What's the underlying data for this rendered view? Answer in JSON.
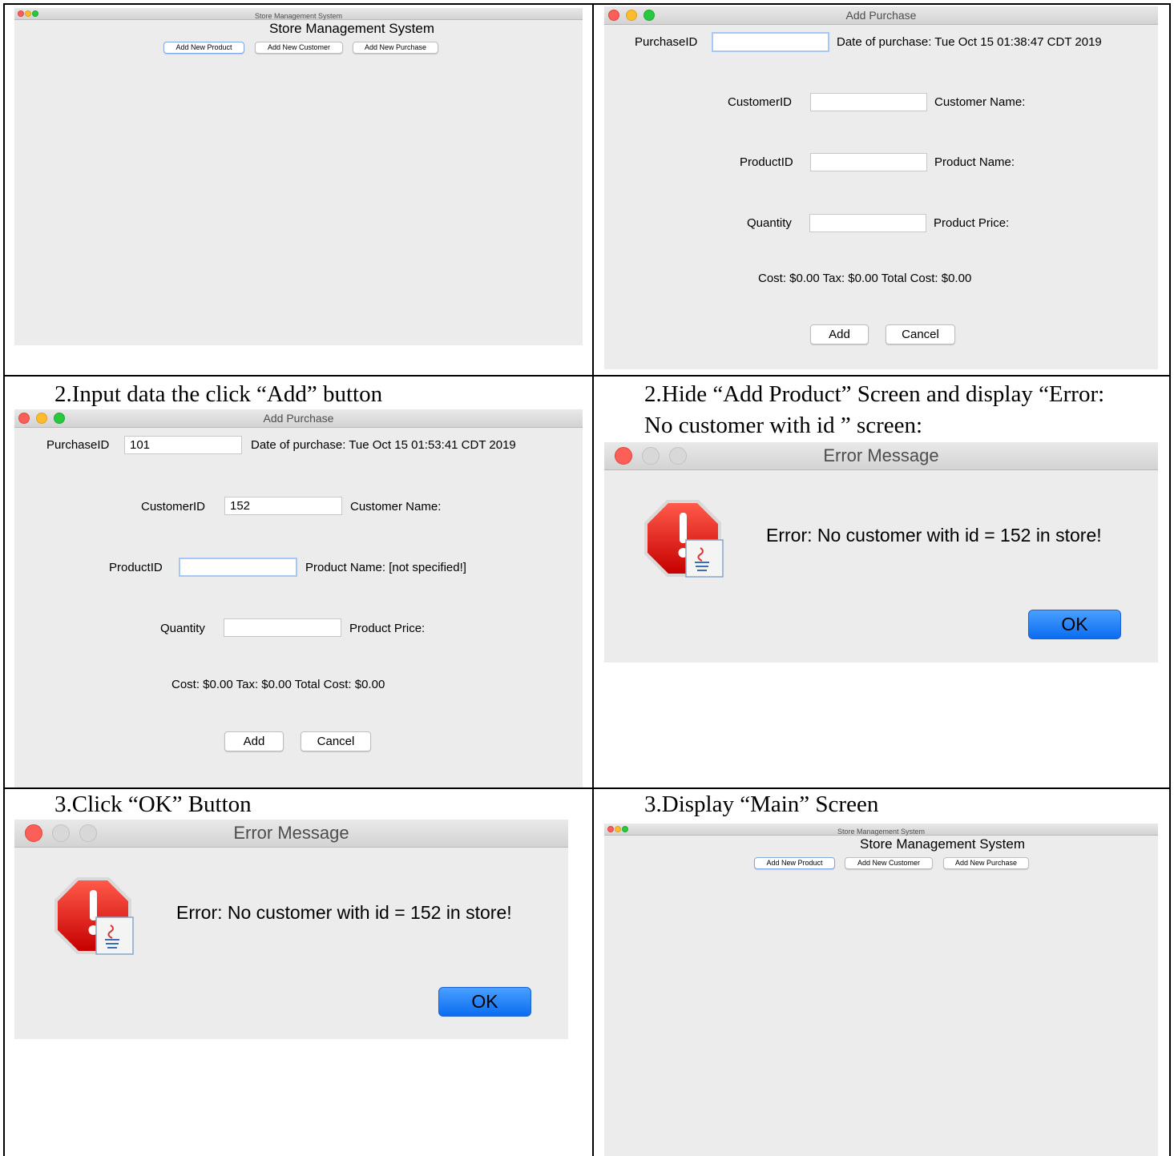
{
  "colors": {
    "window_bg": "#ececec",
    "ok_button": "#0a6cf0",
    "traffic_red": "#fc5f57",
    "traffic_yellow": "#fdbc2e",
    "traffic_green": "#28c840"
  },
  "cell1": {
    "window_title": "Store Management System",
    "heading": "Store Management System",
    "buttons": [
      "Add New Product",
      "Add New Customer",
      "Add New Purchase"
    ]
  },
  "cell2": {
    "window_title": "Add Purchase",
    "purchase_id_label": "PurchaseID",
    "purchase_id_value": "",
    "date_text": "Date of purchase: Tue Oct 15 01:38:47 CDT 2019",
    "customer_id_label": "CustomerID",
    "customer_id_value": "",
    "customer_name_label": "Customer Name:",
    "product_id_label": "ProductID",
    "product_id_value": "",
    "product_name_label": "Product Name:",
    "quantity_label": "Quantity",
    "quantity_value": "",
    "product_price_label": "Product Price:",
    "cost_text": "Cost: $0.00  Tax: $0.00 Total Cost: $0.00",
    "add_label": "Add",
    "cancel_label": "Cancel"
  },
  "cell3": {
    "caption": "2.Input data the click “Add” button",
    "window_title": "Add Purchase",
    "purchase_id_label": "PurchaseID",
    "purchase_id_value": "101",
    "date_text": "Date of purchase: Tue Oct 15 01:53:41 CDT 2019",
    "customer_id_label": "CustomerID",
    "customer_id_value": "152",
    "customer_name_label": "Customer Name:",
    "product_id_label": "ProductID",
    "product_id_value": "",
    "product_name_label": "Product Name: [not specified!]",
    "quantity_label": "Quantity",
    "quantity_value": "",
    "product_price_label": "Product Price:",
    "cost_text": "Cost: $0.00  Tax: $0.00 Total Cost: $0.00",
    "add_label": "Add",
    "cancel_label": "Cancel"
  },
  "cell4": {
    "caption_line1": "2.Hide “Add Product” Screen and display “Error:",
    "caption_line2": "No customer with id ” screen:",
    "window_title": "Error Message",
    "message": "Error: No customer with id = 152 in store!",
    "ok_label": "OK"
  },
  "cell5": {
    "caption": "3.Click “OK” Button",
    "window_title": "Error Message",
    "message": "Error: No customer with id = 152 in store!",
    "ok_label": "OK"
  },
  "cell6": {
    "caption": "3.Display “Main” Screen",
    "window_title": "Store Management System",
    "heading": "Store Management System",
    "buttons": [
      "Add New Product",
      "Add New Customer",
      "Add New Purchase"
    ]
  }
}
